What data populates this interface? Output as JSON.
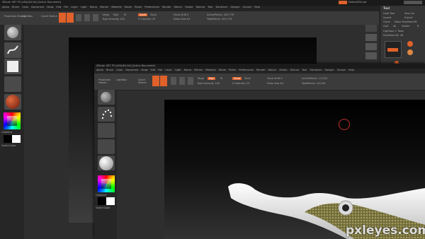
{
  "back": {
    "title": "ZBrush 4R7 P3 (x64)(64 bit) [Active Document]",
    "menu": [
      "Alpha",
      "Brush",
      "Color",
      "Document",
      "Draw",
      "Edit",
      "File",
      "Layer",
      "Light",
      "Macro",
      "Marker",
      "Material",
      "Movie",
      "Picker",
      "Preferences",
      "Render",
      "Stencil",
      "Stroke",
      "Texture",
      "Tool",
      "Transform",
      "Zplugin",
      "Zscript",
      "Help"
    ],
    "shelf": {
      "projection_master": "Projection Master",
      "lightbox": "LightBox",
      "quick_sketch": "Quick Sketch",
      "edit": "Edit",
      "draw": "Draw",
      "move": "Move",
      "scale": "Scale",
      "rotate": "Rotate",
      "mrgb": "Mrgb",
      "rgb": "Rgb",
      "m": "M",
      "rgb_intensity": "Rgb Intensity 100",
      "zadd": "Zadd",
      "zsub": "Zsub",
      "z_intensity": "Z Intensity 25",
      "focal_shift": "Focal Shift 0",
      "draw_size": "Draw Size 64",
      "active_points": "ActivePoints: 453,776",
      "total_points": "TotalPoints: 453,776"
    },
    "switch_label": "SwitchColor",
    "gradient_label": "Gradient",
    "alternate_label": "Alternate",
    "tool_panel": {
      "header": "Tool",
      "load": "Load Tool",
      "save_as": "Save As",
      "import": "Import",
      "export": "Export",
      "clone": "Clone",
      "make_polymesh": "Make PolyMesh3D",
      "goz": "GoZ",
      "all": "All",
      "visible": "Visible",
      "r": "R",
      "lightbox_tools": "Lightbox > Tools",
      "tool_name": "PolyMesh3D: 48",
      "default_script": "DefaultZScript"
    }
  },
  "front": {
    "title": "ZBrush 4R7 P3 (x64)(64 bit) [Active Document]",
    "menu": [
      "Alpha",
      "Brush",
      "Color",
      "Document",
      "Draw",
      "Edit",
      "File",
      "Layer",
      "Light",
      "Macro",
      "Marker",
      "Material",
      "Movie",
      "Picker",
      "Preferences",
      "Render",
      "Stencil",
      "Stroke",
      "Texture",
      "Tool",
      "Transform",
      "Zplugin",
      "Zscript",
      "Help"
    ],
    "shelf": {
      "projection_master": "Projection Master",
      "lightbox": "LightBox",
      "quick_sketch": "Quick Sketch",
      "edit": "Edit",
      "draw": "Draw",
      "move": "Move",
      "scale": "Scale",
      "rotate": "Rotate",
      "mrgb": "Mrgb",
      "rgb": "Rgb",
      "m": "M",
      "rgb_intensity": "Rgb Intensity 100",
      "zadd": "Zadd",
      "zsub": "Zsub",
      "z_intensity": "Z Intensity 25",
      "focal_shift": "Focal Shift 0",
      "draw_size": "Draw Size 64",
      "active_points": "ActivePoints: 13,034",
      "total_points": "TotalPoints: 13,034"
    },
    "switch_label": "SwitchColor",
    "gradient_label": "Gradient"
  },
  "watermark": "pxleyes.com",
  "colors": {
    "accent_orange": "#e0612a",
    "cursor_ring": "#c0302a",
    "croc_skin": "#8a8550"
  }
}
